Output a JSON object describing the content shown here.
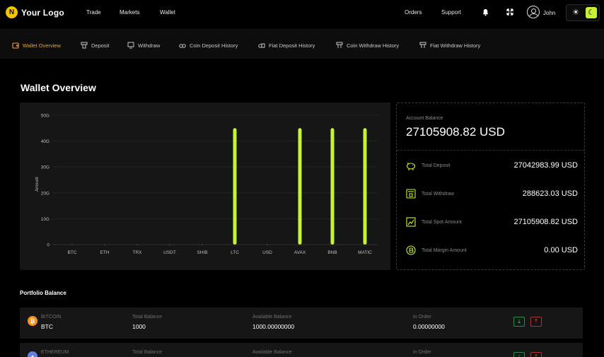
{
  "header": {
    "logo_text": "Your Logo",
    "nav": [
      "Trade",
      "Markets",
      "Wallet"
    ],
    "orders": "Orders",
    "support": "Support",
    "user_name": "John"
  },
  "subnav": {
    "tabs": [
      {
        "label": "Wallet Overview",
        "icon": "wallet-icon",
        "active": true
      },
      {
        "label": "Deposit",
        "icon": "deposit-icon",
        "active": false
      },
      {
        "label": "Withdraw",
        "icon": "withdraw-icon",
        "active": false
      },
      {
        "label": "Coin Deposit History",
        "icon": "coin-deposit-icon",
        "active": false
      },
      {
        "label": "Fiat Deposit History",
        "icon": "fiat-deposit-icon",
        "active": false
      },
      {
        "label": "Coin Withdraw History",
        "icon": "coin-withdraw-icon",
        "active": false
      },
      {
        "label": "Fiat Withdraw History",
        "icon": "fiat-withdraw-icon",
        "active": false
      }
    ]
  },
  "page_title": "Wallet Overview",
  "chart_data": {
    "type": "bar",
    "categories": [
      "BTC",
      "ETH",
      "TRX",
      "USDT",
      "SHIB",
      "LTC",
      "USD",
      "AVAX",
      "BNB",
      "MATIC"
    ],
    "values": [
      0,
      0,
      0,
      0,
      0,
      45,
      0,
      45,
      45,
      45
    ],
    "ylabel": "Amount",
    "ylim": [
      0,
      50
    ],
    "y_ticks": [
      "0",
      "10G",
      "20G",
      "30G",
      "40G",
      "50G"
    ],
    "grid": true,
    "bar_color": "#c6f432"
  },
  "balance": {
    "account_label": "Account Balance",
    "account_value": "27105908.82 USD",
    "stats": [
      {
        "label": "Total Deposit",
        "value": "27042983.99 USD",
        "icon": "piggy-bank-icon"
      },
      {
        "label": "Total Withdraw",
        "value": "288623.03 USD",
        "icon": "atm-withdraw-icon"
      },
      {
        "label": "Total Spot Amount",
        "value": "27105908.82 USD",
        "icon": "spot-chart-icon"
      },
      {
        "label": "Total Margin Amount",
        "value": "0.00 USD",
        "icon": "margin-coin-icon"
      }
    ]
  },
  "portfolio": {
    "title": "Portfolio Balance",
    "columns": [
      "Total Balance",
      "Available Balance",
      "In Order"
    ],
    "rows": [
      {
        "name": "BITCOIN",
        "symbol": "BTC",
        "icon_glyph": "₿",
        "color": "#f7931a",
        "total": "1000",
        "available": "1000.00000000",
        "in_order": "0.00000000"
      },
      {
        "name": "ETHEREUM",
        "symbol": "",
        "icon_glyph": "♦",
        "color": "#627eea",
        "total": "",
        "available": "",
        "in_order": ""
      }
    ]
  },
  "colors": {
    "accent": "#c6f432",
    "active_tab": "#f0a22a"
  }
}
